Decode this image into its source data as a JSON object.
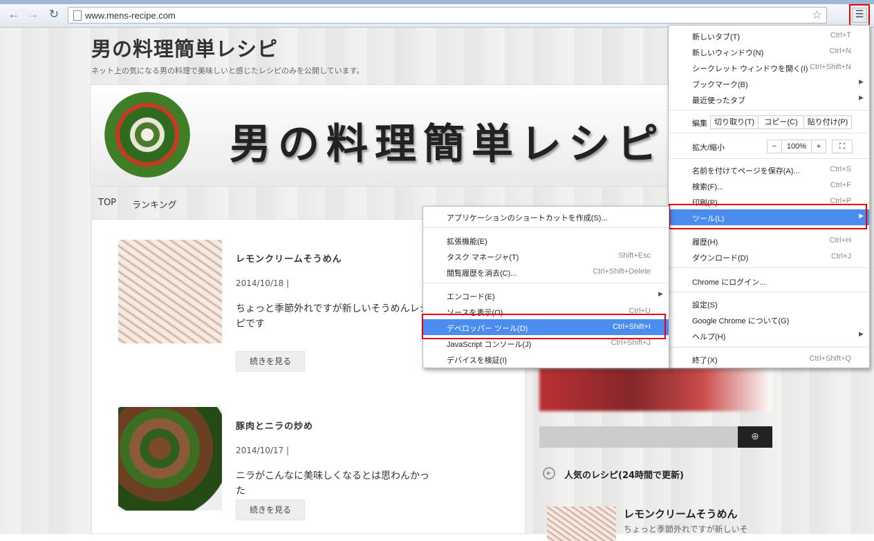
{
  "browser": {
    "url": "www.mens-recipe.com",
    "back_icon": "back-arrow-icon",
    "forward_icon": "forward-arrow-icon",
    "reload_icon": "reload-icon",
    "star_icon": "star-icon",
    "menu_icon": "hamburger-menu-icon",
    "highlight_color": "#ee0000"
  },
  "site": {
    "title": "男の料理簡単レシピ",
    "description": "ネット上の気になる男の料理で美味しいと感じたレシピのみを公開しています。",
    "banner_text": "男の料理簡単レシピ",
    "nav": [
      "TOP",
      "ランキング"
    ]
  },
  "posts": [
    {
      "title": "レモンクリームそうめん",
      "date": "2014/10/18 |",
      "excerpt": "ちょっと季節外れですが新しいそうめんレシピです",
      "more": "続きを見る"
    },
    {
      "title": "豚肉とニラの炒め",
      "date": "2014/10/17 |",
      "excerpt": "ニラがこんなに美味しくなるとは思わんかった",
      "more": "続きを見る"
    }
  ],
  "sidebar": {
    "popular_title": "人気のレシピ(24時間で更新)",
    "popular_item_title": "レモンクリームそうめん",
    "popular_item_excerpt": "ちょっと季節外れですが新しいそ"
  },
  "chrome_menu": {
    "items": [
      {
        "label": "新しいタブ(T)",
        "shortcut": "Ctrl+T"
      },
      {
        "label": "新しいウィンドウ(N)",
        "shortcut": "Ctrl+N"
      },
      {
        "label": "シークレット ウィンドウを開く(I)",
        "shortcut": "Ctrl+Shift+N"
      },
      {
        "label": "ブックマーク(B)",
        "shortcut": ""
      },
      {
        "label": "最近使ったタブ",
        "shortcut": ""
      }
    ],
    "edit": {
      "label": "編集",
      "cut": "切り取り(T)",
      "copy": "コピー(C)",
      "paste": "貼り付け(P)"
    },
    "zoom": {
      "label": "拡大/縮小",
      "minus": "−",
      "value": "100%",
      "plus": "+"
    },
    "items2": [
      {
        "label": "名前を付けてページを保存(A)...",
        "shortcut": "Ctrl+S"
      },
      {
        "label": "検索(F)...",
        "shortcut": "Ctrl+F"
      },
      {
        "label": "印刷(P)...",
        "shortcut": "Ctrl+P"
      },
      {
        "label": "ツール(L)",
        "shortcut": ""
      }
    ],
    "items3": [
      {
        "label": "履歴(H)",
        "shortcut": "Ctrl+H"
      },
      {
        "label": "ダウンロード(D)",
        "shortcut": "Ctrl+J"
      },
      {
        "label": "Chrome にログイン...",
        "shortcut": ""
      },
      {
        "label": "設定(S)",
        "shortcut": ""
      },
      {
        "label": "Google Chrome について(G)",
        "shortcut": ""
      },
      {
        "label": "ヘルプ(H)",
        "shortcut": ""
      },
      {
        "label": "終了(X)",
        "shortcut": "Ctrl+Shift+Q"
      }
    ]
  },
  "tools_menu": {
    "items": [
      {
        "label": "アプリケーションのショートカットを作成(S)...",
        "shortcut": ""
      },
      {
        "label": "拡張機能(E)",
        "shortcut": ""
      },
      {
        "label": "タスク マネージャ(T)",
        "shortcut": "Shift+Esc"
      },
      {
        "label": "閲覧履歴を消去(C)...",
        "shortcut": "Ctrl+Shift+Delete"
      },
      {
        "label": "エンコード(E)",
        "shortcut": ""
      },
      {
        "label": "ソースを表示(O)",
        "shortcut": "Ctrl+U"
      },
      {
        "label": "デベロッパー ツール(D)",
        "shortcut": "Ctrl+Shift+I"
      },
      {
        "label": "JavaScript コンソール(J)",
        "shortcut": "Ctrl+Shift+J"
      },
      {
        "label": "デバイスを検証(I)",
        "shortcut": ""
      }
    ]
  },
  "colors": {
    "menu_highlight": "#4a8cf0",
    "page_bg": "#eeeeec"
  }
}
